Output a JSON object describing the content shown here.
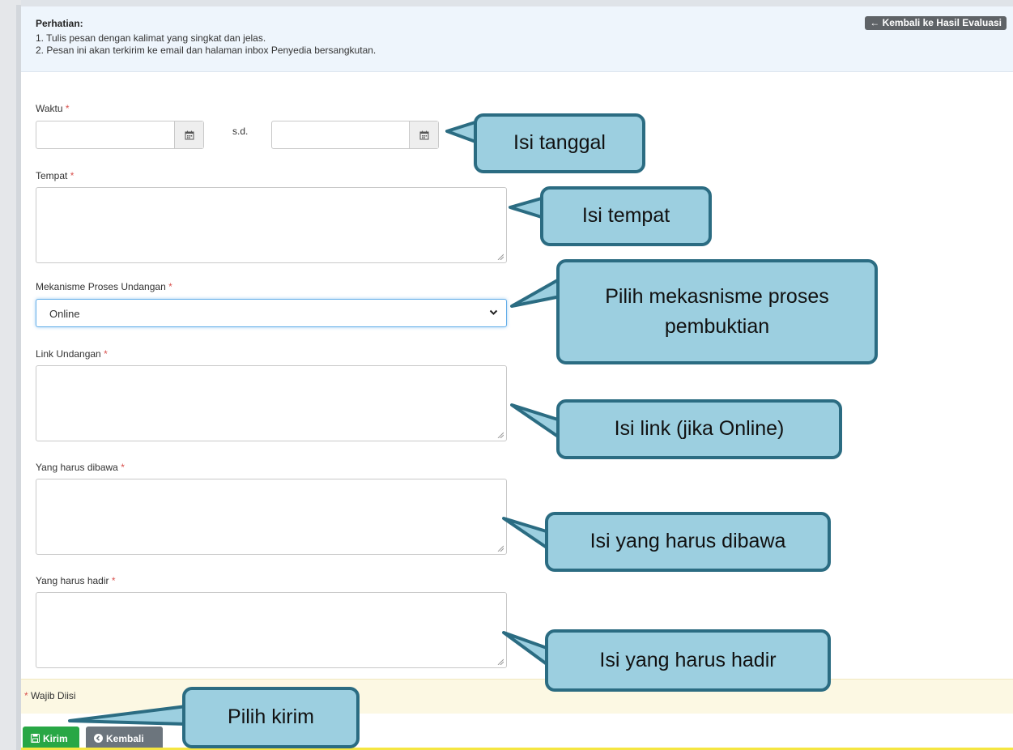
{
  "notice": {
    "title": "Perhatian:",
    "line1": "1. Tulis pesan dengan kalimat yang singkat dan jelas.",
    "line2": "2. Pesan ini akan terkirim ke email dan halaman inbox Penyedia bersangkutan.",
    "back_button": "← Kembali ke Hasil Evaluasi"
  },
  "form": {
    "waktu_label": "Waktu",
    "sd_label": "s.d.",
    "tempat_label": "Tempat",
    "mekanisme_label": "Mekanisme Proses Undangan",
    "mekanisme_value": "Online",
    "link_label": "Link Undangan",
    "dibawa_label": "Yang harus dibawa",
    "hadir_label": "Yang harus hadir",
    "required_mark": "*",
    "wajib_text": "Wajib Diisi"
  },
  "buttons": {
    "kirim": "Kirim",
    "kembali": "Kembali"
  },
  "callouts": {
    "tanggal": "Isi tanggal",
    "tempat": "Isi tempat",
    "mekanisme": "Pilih mekasnisme proses pembuktian",
    "link": "Isi link (jika Online)",
    "dibawa": "Isi yang harus dibawa",
    "hadir": "Isi yang harus hadir",
    "kirim": "Pilih kirim"
  },
  "colors": {
    "callout_fill": "#9ccfe0",
    "callout_border": "#2b6c82",
    "kirim_button": "#28a745",
    "kembali_button": "#6c757d"
  },
  "icons": [
    "calendar-icon",
    "chevron-down-icon",
    "save-icon",
    "arrow-left-circle-icon",
    "resize-handle-icon"
  ]
}
